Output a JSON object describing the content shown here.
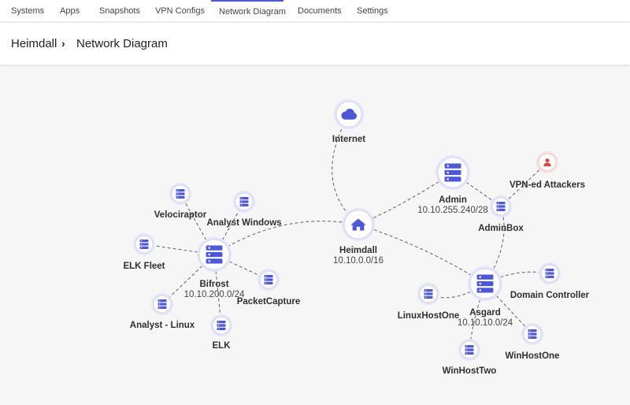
{
  "tabs": [
    "Systems",
    "Apps",
    "Snapshots",
    "VPN Configs",
    "Network Diagram",
    "Documents",
    "Settings"
  ],
  "active_tab": "Network Diagram",
  "breadcrumb": {
    "root": "Heimdall",
    "current": "Network Diagram"
  },
  "colors": {
    "accent": "#4e57d6",
    "danger": "#e04343",
    "edge": "#6d6d6d"
  },
  "nodes": [
    {
      "id": "internet",
      "label": "Internet",
      "subnet": "",
      "icon": "cloud-icon",
      "kind": "cloud"
    },
    {
      "id": "heimdall",
      "label": "Heimdall",
      "subnet": "10.10.0.0/16",
      "icon": "home-icon",
      "kind": "hub"
    },
    {
      "id": "admin",
      "label": "Admin",
      "subnet": "10.10.255.240/28",
      "icon": "server-icon",
      "kind": "network"
    },
    {
      "id": "vpn",
      "label": "VPN-ed Attackers",
      "subnet": "",
      "icon": "user-icon",
      "kind": "attacker"
    },
    {
      "id": "adminbox",
      "label": "AdminBox",
      "subnet": "",
      "icon": "server-icon",
      "kind": "host"
    },
    {
      "id": "bifrost",
      "label": "Bifrost",
      "subnet": "10.10.200.0/24",
      "icon": "server-icon",
      "kind": "network"
    },
    {
      "id": "velociraptor",
      "label": "Velociraptor",
      "subnet": "",
      "icon": "server-icon",
      "kind": "host"
    },
    {
      "id": "analystwin",
      "label": "Analyst Windows",
      "subnet": "",
      "icon": "server-icon",
      "kind": "host"
    },
    {
      "id": "elkfleet",
      "label": "ELK Fleet",
      "subnet": "",
      "icon": "server-icon",
      "kind": "host"
    },
    {
      "id": "packetcapture",
      "label": "PacketCapture",
      "subnet": "",
      "icon": "server-icon",
      "kind": "host"
    },
    {
      "id": "analystlinux",
      "label": "Analyst - Linux",
      "subnet": "",
      "icon": "server-icon",
      "kind": "host"
    },
    {
      "id": "elk",
      "label": "ELK",
      "subnet": "",
      "icon": "server-icon",
      "kind": "host"
    },
    {
      "id": "asgard",
      "label": "Asgard",
      "subnet": "10.10.10.0/24",
      "icon": "server-icon",
      "kind": "network"
    },
    {
      "id": "dc",
      "label": "Domain Controller",
      "subnet": "",
      "icon": "server-icon",
      "kind": "host"
    },
    {
      "id": "linuxhostone",
      "label": "LinuxHostOne",
      "subnet": "",
      "icon": "server-icon",
      "kind": "host"
    },
    {
      "id": "winhostone",
      "label": "WinHostOne",
      "subnet": "",
      "icon": "server-icon",
      "kind": "host"
    },
    {
      "id": "winhosttwo",
      "label": "WinHostTwo",
      "subnet": "",
      "icon": "server-icon",
      "kind": "host"
    }
  ],
  "edges": [
    [
      "internet",
      "heimdall"
    ],
    [
      "heimdall",
      "admin"
    ],
    [
      "heimdall",
      "bifrost"
    ],
    [
      "heimdall",
      "asgard"
    ],
    [
      "admin",
      "adminbox"
    ],
    [
      "adminbox",
      "vpn"
    ],
    [
      "adminbox",
      "asgard"
    ],
    [
      "bifrost",
      "velociraptor"
    ],
    [
      "bifrost",
      "analystwin"
    ],
    [
      "bifrost",
      "elkfleet"
    ],
    [
      "bifrost",
      "packetcapture"
    ],
    [
      "bifrost",
      "analystlinux"
    ],
    [
      "bifrost",
      "elk"
    ],
    [
      "asgard",
      "dc"
    ],
    [
      "asgard",
      "linuxhostone"
    ],
    [
      "asgard",
      "winhostone"
    ],
    [
      "asgard",
      "winhosttwo"
    ]
  ]
}
